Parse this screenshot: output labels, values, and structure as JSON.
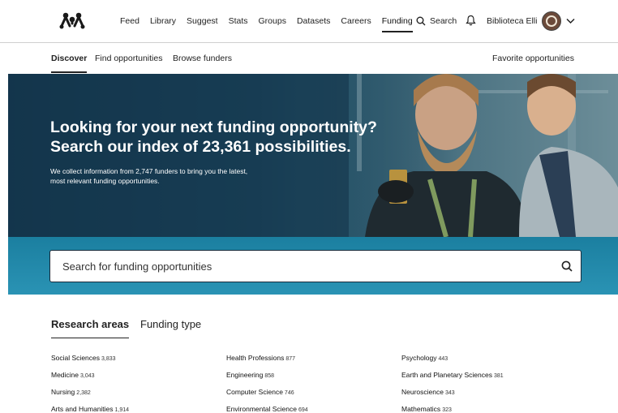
{
  "nav": {
    "items": [
      {
        "label": "Feed",
        "active": false
      },
      {
        "label": "Library",
        "active": false
      },
      {
        "label": "Suggest",
        "active": false
      },
      {
        "label": "Stats",
        "active": false
      },
      {
        "label": "Groups",
        "active": false
      },
      {
        "label": "Datasets",
        "active": false
      },
      {
        "label": "Careers",
        "active": false
      },
      {
        "label": "Funding",
        "active": true
      }
    ],
    "search_label": "Search",
    "user_name": "Biblioteca Elli"
  },
  "subnav": {
    "discover": "Discover",
    "find": "Find opportunities",
    "browse": "Browse funders",
    "favorite": "Favorite opportunities"
  },
  "hero": {
    "title_line1": "Looking for your next funding opportunity?",
    "title_line2": "Search our index of 23,361 possibilities.",
    "subtitle_line1": "We collect information from 2,747 funders to bring you the latest,",
    "subtitle_line2": "most relevant funding opportunities."
  },
  "search": {
    "placeholder": "Search for funding opportunities"
  },
  "tabs": {
    "research": "Research areas",
    "funding_type": "Funding type"
  },
  "areas": {
    "col1": [
      {
        "name": "Social Sciences",
        "count": "3,833"
      },
      {
        "name": "Medicine",
        "count": "3,043"
      },
      {
        "name": "Nursing",
        "count": "2,382"
      },
      {
        "name": "Arts and Humanities",
        "count": "1,914"
      }
    ],
    "col2": [
      {
        "name": "Health Professions",
        "count": "877"
      },
      {
        "name": "Engineering",
        "count": "858"
      },
      {
        "name": "Computer Science",
        "count": "746"
      },
      {
        "name": "Environmental Science",
        "count": "694"
      }
    ],
    "col3": [
      {
        "name": "Psychology",
        "count": "443"
      },
      {
        "name": "Earth and Planetary Sciences",
        "count": "381"
      },
      {
        "name": "Neuroscience",
        "count": "343"
      },
      {
        "name": "Mathematics",
        "count": "323"
      }
    ]
  }
}
